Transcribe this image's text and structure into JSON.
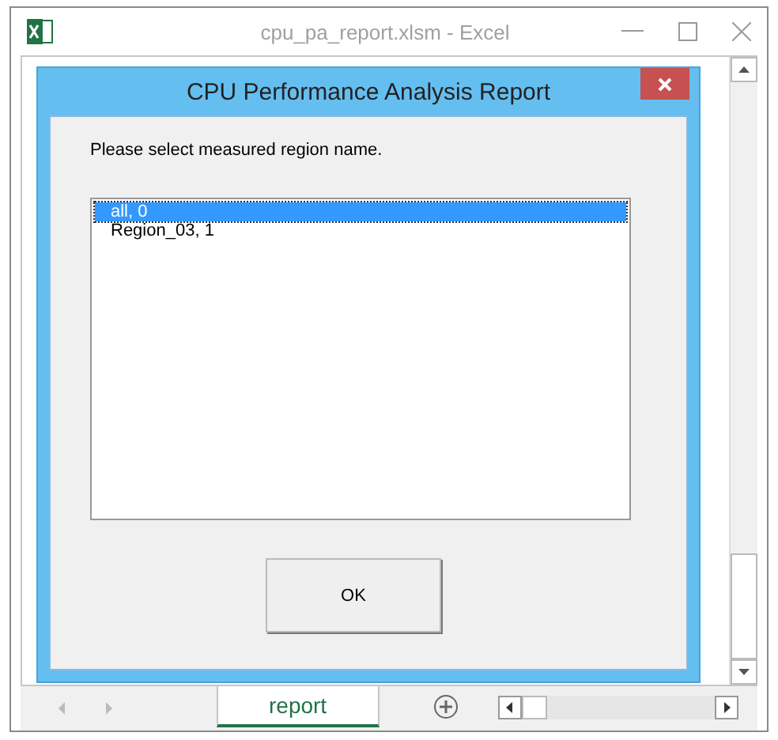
{
  "window": {
    "title": "cpu_pa_report.xlsm - Excel"
  },
  "dialog": {
    "title": "CPU Performance Analysis Report",
    "prompt": "Please select measured region name.",
    "items": [
      {
        "label": "all, 0",
        "selected": true
      },
      {
        "label": "Region_03, 1",
        "selected": false
      }
    ],
    "button": "OK"
  },
  "sheet_tabs": [
    {
      "label": "report",
      "selected": true
    }
  ]
}
